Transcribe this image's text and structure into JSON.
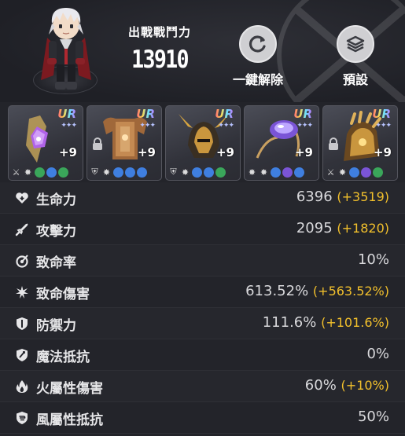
{
  "header": {
    "power_label": "出戰戰鬥力",
    "power_value": "13910",
    "unequip_label": "一鍵解除",
    "preset_label": "預設"
  },
  "equipment": [
    {
      "grade": "UR",
      "enhance": "+9",
      "locked": false,
      "art": "purple-crystal-ring-icon"
    },
    {
      "grade": "UR",
      "enhance": "+9",
      "locked": true,
      "art": "bronze-armor-icon"
    },
    {
      "grade": "UR",
      "enhance": "+9",
      "locked": false,
      "art": "horned-helmet-icon"
    },
    {
      "grade": "UR",
      "enhance": "+9",
      "locked": false,
      "art": "amethyst-amulet-icon"
    },
    {
      "grade": "UR",
      "enhance": "+9",
      "locked": true,
      "art": "golden-gauntlet-icon"
    }
  ],
  "stats": [
    {
      "icon": "heart-plus-icon",
      "name": "生命力",
      "value": "6396",
      "bonus": "(+3519)"
    },
    {
      "icon": "sword-icon",
      "name": "攻擊力",
      "value": "2095",
      "bonus": "(+1820)"
    },
    {
      "icon": "crit-rate-icon",
      "name": "致命率",
      "value": "10%",
      "bonus": ""
    },
    {
      "icon": "crit-damage-icon",
      "name": "致命傷害",
      "value": "613.52%",
      "bonus": "(+563.52%)"
    },
    {
      "icon": "shield-icon",
      "name": "防禦力",
      "value": "111.6%",
      "bonus": "(+101.6%)"
    },
    {
      "icon": "magic-resist-icon",
      "name": "魔法抵抗",
      "value": "0%",
      "bonus": ""
    },
    {
      "icon": "fire-icon",
      "name": "火屬性傷害",
      "value": "60%",
      "bonus": "(+10%)"
    },
    {
      "icon": "wind-resist-icon",
      "name": "風屬性抵抗",
      "value": "50%",
      "bonus": ""
    }
  ],
  "colors": {
    "background": "#23242a",
    "bonus": "#f2c02c",
    "text": "#e6e6e8"
  }
}
